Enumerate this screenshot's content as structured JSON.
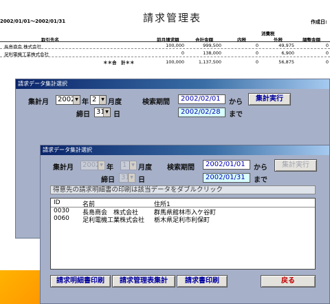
{
  "report": {
    "date_range": "2002/01/01～2002/01/31",
    "title": "請求管理表",
    "created_label": "作成日:",
    "tax_group_label": "消費税",
    "columns": [
      "取引先名",
      "前月請求額",
      "合計金額",
      "内税",
      "外税",
      "調整金額"
    ],
    "rows": [
      {
        "name": "長島商会 株式会社",
        "prev": "100,000",
        "total": "999,500",
        "inner": "0",
        "outer": "49,975",
        "adj": "0"
      },
      {
        "name": "足利電機工業株式会社",
        "prev": "0",
        "total": "138,000",
        "inner": "0",
        "outer": "6,900",
        "adj": "0"
      }
    ],
    "total_label": "＊＊合　計＊＊",
    "totals": {
      "prev": "100,000",
      "total": "1,137,500",
      "inner": "0",
      "outer": "56,875",
      "adj": "0"
    }
  },
  "dialog1": {
    "title": "請求データ集計選択",
    "fiscal_month_label": "集計月",
    "year_value": "2002",
    "year_unit": "年",
    "month_value": "2",
    "month_unit": "月度",
    "period_label": "検索期間",
    "period_from": "2002/02/01",
    "from_word": "から",
    "period_to": "2002/02/28",
    "to_word": "まで",
    "closing_label": "締日",
    "closing_value": "31",
    "closing_unit": "日",
    "run_button": "集計実行"
  },
  "dialog2": {
    "title": "請求データ集計選択",
    "fiscal_month_label": "集計月",
    "year_value": "2002",
    "year_unit": "年",
    "month_value": "1",
    "month_unit": "月度",
    "period_label": "検索期間",
    "period_from": "2002/01/01",
    "from_word": "から",
    "period_to": "2002/01/31",
    "to_word": "まで",
    "closing_label": "締日",
    "closing_value": "31",
    "closing_unit": "日",
    "run_button": "集計実行",
    "instruction": "得意先の請求明細書の印刷は該当データをダブルクリック",
    "list": {
      "headers": [
        "ID",
        "名前",
        "住所1"
      ],
      "rows": [
        {
          "id": "0030",
          "name": "長島商会　株式会社",
          "address": "群馬県館林市入ケ谷町"
        },
        {
          "id": "0060",
          "name": "足利電機工業株式会社",
          "address": "栃木県足利市利保町"
        }
      ]
    },
    "buttons": {
      "detail_print": "請求明細書印刷",
      "summary": "請求管理表集計",
      "invoice_print": "請求書印刷",
      "back": "戻る"
    }
  }
}
